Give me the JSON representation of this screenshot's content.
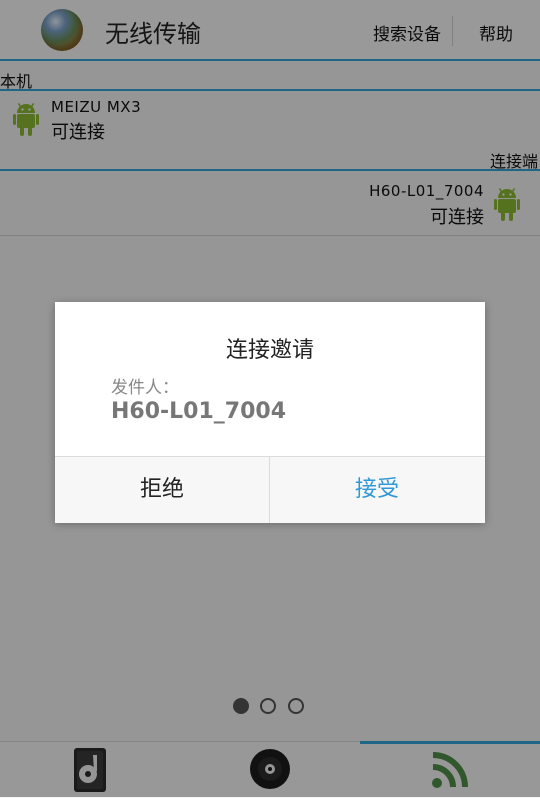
{
  "header": {
    "title": "无线传输",
    "search_label": "搜索设备",
    "help_label": "帮助",
    "accent_color": "#33a3d9"
  },
  "local": {
    "section_label": "本机",
    "device_name": "MEIZU MX3",
    "status": "可连接",
    "icon": "android-icon"
  },
  "remote": {
    "section_label": "连接端",
    "device_name": "H60-L01_7004",
    "status": "可连接",
    "icon": "android-icon"
  },
  "dialog": {
    "title": "连接邀请",
    "sender_label": "发件人：",
    "sender_name": "H60-L01_7004",
    "reject_label": "拒绝",
    "accept_label": "接受",
    "accept_color": "#2f98d6"
  },
  "pager": {
    "total": 3,
    "current": 1
  },
  "tabs": [
    {
      "icon": "music-player-icon",
      "selected": false
    },
    {
      "icon": "disc-icon",
      "selected": false
    },
    {
      "icon": "wireless-icon",
      "selected": true
    }
  ]
}
